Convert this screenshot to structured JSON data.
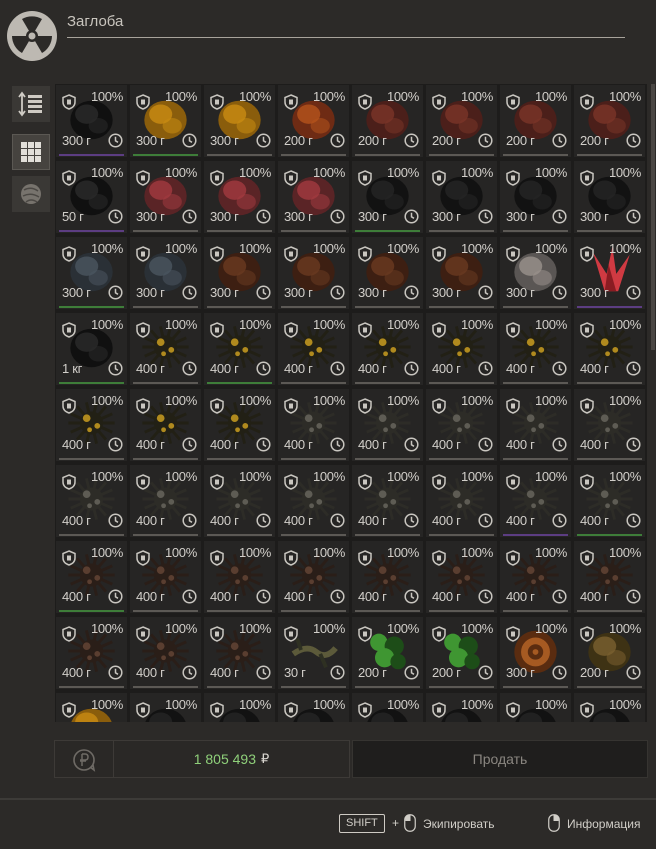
{
  "window": {
    "title": "Заглоба"
  },
  "sidebar": [
    {
      "name": "sort-button",
      "icon": "sort-arrows-icon",
      "active": false
    },
    {
      "name": "grid-view-button",
      "icon": "grid-icon",
      "active": true
    },
    {
      "name": "artifacts-filter-button",
      "icon": "artifact-icon",
      "active": false
    }
  ],
  "colors": {
    "cell_bg": "#262524",
    "underline_green": "#3e7d39",
    "underline_purple": "#5c3d82",
    "underline_gray": "#5c5955",
    "total_green": "#8fd07a"
  },
  "items": [
    {
      "c": "100%",
      "w": "300 г",
      "a": "black",
      "u": "purple"
    },
    {
      "c": "100%",
      "w": "300 г",
      "a": "amber",
      "u": "green"
    },
    {
      "c": "100%",
      "w": "300 г",
      "a": "amber",
      "u": "gray"
    },
    {
      "c": "100%",
      "w": "200 г",
      "a": "rust",
      "u": "gray"
    },
    {
      "c": "100%",
      "w": "200 г",
      "a": "redbrown",
      "u": "gray"
    },
    {
      "c": "100%",
      "w": "200 г",
      "a": "redbrown",
      "u": "gray"
    },
    {
      "c": "100%",
      "w": "200 г",
      "a": "redbrown",
      "u": "gray"
    },
    {
      "c": "100%",
      "w": "200 г",
      "a": "redbrown",
      "u": "gray"
    },
    {
      "c": "100%",
      "w": "50 г",
      "a": "black",
      "u": "purple"
    },
    {
      "c": "100%",
      "w": "300 г",
      "a": "pink",
      "u": "gray"
    },
    {
      "c": "100%",
      "w": "300 г",
      "a": "pink",
      "u": "gray"
    },
    {
      "c": "100%",
      "w": "300 г",
      "a": "pink",
      "u": "gray"
    },
    {
      "c": "100%",
      "w": "300 г",
      "a": "dark",
      "u": "green"
    },
    {
      "c": "100%",
      "w": "300 г",
      "a": "dark",
      "u": "gray"
    },
    {
      "c": "100%",
      "w": "300 г",
      "a": "dark",
      "u": "gray"
    },
    {
      "c": "100%",
      "w": "300 г",
      "a": "dark",
      "u": "gray"
    },
    {
      "c": "100%",
      "w": "300 г",
      "a": "slate",
      "u": "green"
    },
    {
      "c": "100%",
      "w": "300 г",
      "a": "slate",
      "u": "gray"
    },
    {
      "c": "100%",
      "w": "300 г",
      "a": "brown",
      "u": "gray"
    },
    {
      "c": "100%",
      "w": "300 г",
      "a": "brown",
      "u": "gray"
    },
    {
      "c": "100%",
      "w": "300 г",
      "a": "brown",
      "u": "gray"
    },
    {
      "c": "100%",
      "w": "300 г",
      "a": "brown",
      "u": "gray"
    },
    {
      "c": "100%",
      "w": "300 г",
      "a": "silver",
      "u": "gray"
    },
    {
      "c": "100%",
      "w": "300 г",
      "a": "crystal",
      "u": "purple"
    },
    {
      "c": "100%",
      "w": "1 кг",
      "a": "black",
      "u": "green"
    },
    {
      "c": "100%",
      "w": "400 г",
      "a": "spikeyellow",
      "u": "gray"
    },
    {
      "c": "100%",
      "w": "400 г",
      "a": "spikeyellow",
      "u": "green"
    },
    {
      "c": "100%",
      "w": "400 г",
      "a": "spikeyellow",
      "u": "gray"
    },
    {
      "c": "100%",
      "w": "400 г",
      "a": "spikeyellow",
      "u": "gray"
    },
    {
      "c": "100%",
      "w": "400 г",
      "a": "spikeyellow",
      "u": "gray"
    },
    {
      "c": "100%",
      "w": "400 г",
      "a": "spikeyellow",
      "u": "gray"
    },
    {
      "c": "100%",
      "w": "400 г",
      "a": "spikeyellow",
      "u": "gray"
    },
    {
      "c": "100%",
      "w": "400 г",
      "a": "spikeyellow",
      "u": "gray"
    },
    {
      "c": "100%",
      "w": "400 г",
      "a": "spikeyellow",
      "u": "gray"
    },
    {
      "c": "100%",
      "w": "400 г",
      "a": "spikeyellow",
      "u": "gray"
    },
    {
      "c": "100%",
      "w": "400 г",
      "a": "spikegray",
      "u": "gray"
    },
    {
      "c": "100%",
      "w": "400 г",
      "a": "spikegray",
      "u": "gray"
    },
    {
      "c": "100%",
      "w": "400 г",
      "a": "spikegray",
      "u": "gray"
    },
    {
      "c": "100%",
      "w": "400 г",
      "a": "spikegray",
      "u": "gray"
    },
    {
      "c": "100%",
      "w": "400 г",
      "a": "spikegray",
      "u": "gray"
    },
    {
      "c": "100%",
      "w": "400 г",
      "a": "spikegray",
      "u": "gray"
    },
    {
      "c": "100%",
      "w": "400 г",
      "a": "spikegray",
      "u": "gray"
    },
    {
      "c": "100%",
      "w": "400 г",
      "a": "spikegray",
      "u": "gray"
    },
    {
      "c": "100%",
      "w": "400 г",
      "a": "spikegray",
      "u": "gray"
    },
    {
      "c": "100%",
      "w": "400 г",
      "a": "spikegray",
      "u": "gray"
    },
    {
      "c": "100%",
      "w": "400 г",
      "a": "spikegray",
      "u": "gray"
    },
    {
      "c": "100%",
      "w": "400 г",
      "a": "spikegray",
      "u": "purple"
    },
    {
      "c": "100%",
      "w": "400 г",
      "a": "spikegray",
      "u": "green"
    },
    {
      "c": "100%",
      "w": "400 г",
      "a": "spikebrown",
      "u": "green"
    },
    {
      "c": "100%",
      "w": "400 г",
      "a": "spikebrown",
      "u": "gray"
    },
    {
      "c": "100%",
      "w": "400 г",
      "a": "spikebrown",
      "u": "gray"
    },
    {
      "c": "100%",
      "w": "400 г",
      "a": "spikebrown",
      "u": "gray"
    },
    {
      "c": "100%",
      "w": "400 г",
      "a": "spikebrown",
      "u": "gray"
    },
    {
      "c": "100%",
      "w": "400 г",
      "a": "spikebrown",
      "u": "gray"
    },
    {
      "c": "100%",
      "w": "400 г",
      "a": "spikebrown",
      "u": "gray"
    },
    {
      "c": "100%",
      "w": "400 г",
      "a": "spikebrown",
      "u": "gray"
    },
    {
      "c": "100%",
      "w": "400 г",
      "a": "spikebrown",
      "u": "gray"
    },
    {
      "c": "100%",
      "w": "400 г",
      "a": "spikebrown",
      "u": "gray"
    },
    {
      "c": "100%",
      "w": "400 г",
      "a": "spikebrown",
      "u": "gray"
    },
    {
      "c": "100%",
      "w": "30 г",
      "a": "branch",
      "u": "gray"
    },
    {
      "c": "100%",
      "w": "200 г",
      "a": "green",
      "u": "gray"
    },
    {
      "c": "100%",
      "w": "200 г",
      "a": "green",
      "u": "gray"
    },
    {
      "c": "100%",
      "w": "300 г",
      "a": "coil",
      "u": "gray"
    },
    {
      "c": "100%",
      "w": "200 г",
      "a": "olive",
      "u": "gray"
    },
    {
      "c": "100%",
      "w": "",
      "a": "amber",
      "u": "gray"
    },
    {
      "c": "100%",
      "w": "",
      "a": "dark",
      "u": "gray"
    },
    {
      "c": "100%",
      "w": "",
      "a": "dark",
      "u": "gray"
    },
    {
      "c": "100%",
      "w": "",
      "a": "dark",
      "u": "gray"
    },
    {
      "c": "100%",
      "w": "",
      "a": "dark",
      "u": "gray"
    },
    {
      "c": "100%",
      "w": "",
      "a": "dark",
      "u": "gray"
    },
    {
      "c": "100%",
      "w": "",
      "a": "dark",
      "u": "gray"
    },
    {
      "c": "100%",
      "w": "",
      "a": "dark",
      "u": "gray"
    }
  ],
  "sale": {
    "total": "1 805 493",
    "currency": "₽",
    "sell_label": "Продать",
    "reset_icon": "ruble-refresh-icon"
  },
  "hints": {
    "shift_key": "SHIFT",
    "plus": "+",
    "equip_label": "Экипировать",
    "info_label": "Информация"
  }
}
